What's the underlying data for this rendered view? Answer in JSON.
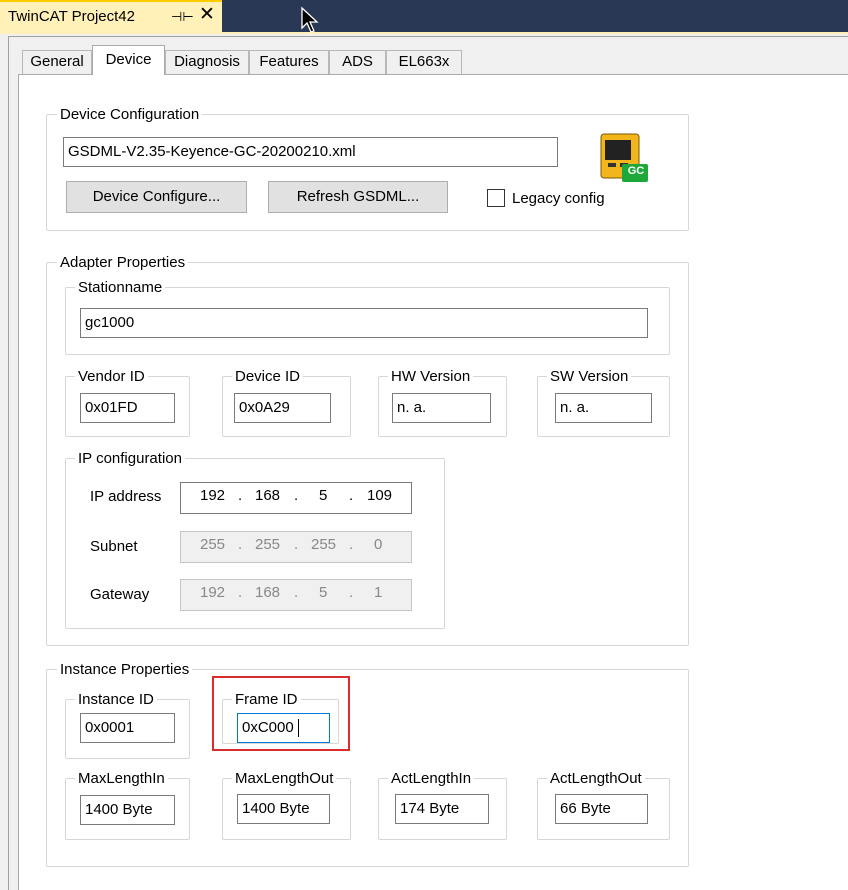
{
  "window": {
    "tab_title": "TwinCAT Project42",
    "pin_glyph": "⊣⊢",
    "close_glyph": "✕"
  },
  "tabs": [
    {
      "label": "General"
    },
    {
      "label": "Device"
    },
    {
      "label": "Diagnosis"
    },
    {
      "label": "Features"
    },
    {
      "label": "ADS"
    },
    {
      "label": "EL663x"
    }
  ],
  "device_configuration": {
    "group_label": "Device Configuration",
    "gsdml_file": "GSDML-V2.35-Keyence-GC-20200210.xml",
    "configure_button": "Device Configure...",
    "refresh_button": "Refresh GSDML...",
    "legacy_config_label": "Legacy config",
    "device_badge": "GC"
  },
  "adapter_properties": {
    "group_label": "Adapter Properties",
    "stationname_label": "Stationname",
    "stationname_value": "gc1000",
    "vendor_id_label": "Vendor ID",
    "vendor_id_value": "0x01FD",
    "device_id_label": "Device ID",
    "device_id_value": "0x0A29",
    "hw_version_label": "HW Version",
    "hw_version_value": "n. a.",
    "sw_version_label": "SW Version",
    "sw_version_value": "n. a."
  },
  "ip_configuration": {
    "group_label": "IP configuration",
    "ip_address_label": "IP address",
    "ip_address": [
      "192",
      "168",
      "5",
      "109"
    ],
    "subnet_label": "Subnet",
    "subnet": [
      "255",
      "255",
      "255",
      "0"
    ],
    "gateway_label": "Gateway",
    "gateway": [
      "192",
      "168",
      "5",
      "1"
    ],
    "dot": "."
  },
  "instance_properties": {
    "group_label": "Instance Properties",
    "instance_id_label": "Instance ID",
    "instance_id_value": "0x0001",
    "frame_id_label": "Frame ID",
    "frame_id_value": "0xC000",
    "max_length_in_label": "MaxLengthIn",
    "max_length_in_value": "1400 Byte",
    "max_length_out_label": "MaxLengthOut",
    "max_length_out_value": "1400 Byte",
    "act_length_in_label": "ActLengthIn",
    "act_length_in_value": "174 Byte",
    "act_length_out_label": "ActLengthOut",
    "act_length_out_value": "66 Byte"
  },
  "colors": {
    "accent_frame": "#293955",
    "active_doc_tab": "#fff1b8",
    "highlight": "#d92c2c",
    "badge_green": "#1fa83a"
  }
}
